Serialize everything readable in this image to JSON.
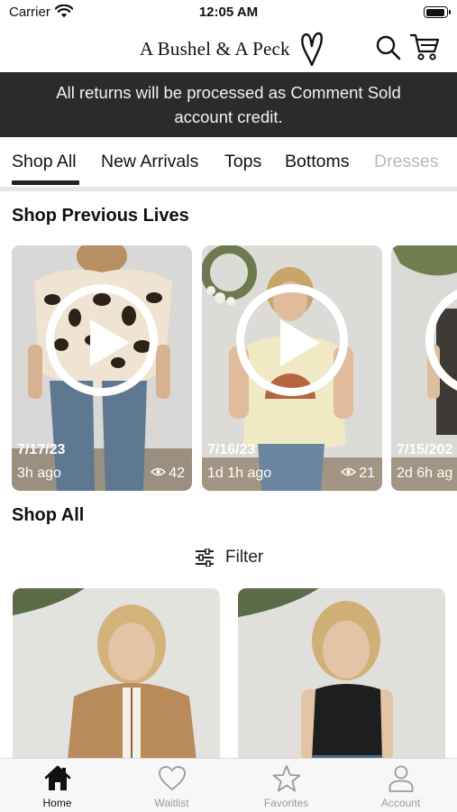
{
  "status_bar": {
    "carrier": "Carrier",
    "time": "12:05 AM",
    "battery_level": 0.95
  },
  "header": {
    "brand": "A Bushel & A Peck",
    "icons": [
      "heart-logo-icon",
      "search-icon",
      "cart-icon"
    ]
  },
  "banner": {
    "line1": "All returns will be processed as Comment Sold",
    "line2": "account credit."
  },
  "tabs": [
    {
      "label": "Shop All",
      "active": true
    },
    {
      "label": "New Arrivals",
      "active": false
    },
    {
      "label": "Tops",
      "active": false
    },
    {
      "label": "Bottoms",
      "active": false
    },
    {
      "label": "Dresses",
      "active": false
    }
  ],
  "previous_lives": {
    "title": "Shop Previous Lives",
    "items": [
      {
        "date": "7/17/23",
        "ago": "3h ago",
        "views": "42"
      },
      {
        "date": "7/16/23",
        "ago": "1d 1h ago",
        "views": "21"
      },
      {
        "date": "7/15/202",
        "ago": "2d 6h ag",
        "views": ""
      }
    ]
  },
  "shop_all": {
    "title": "Shop All",
    "filter_label": "Filter"
  },
  "tabbar": [
    {
      "label": "Home",
      "icon": "home-icon",
      "active": true
    },
    {
      "label": "Waitlist",
      "icon": "heart-icon",
      "active": false
    },
    {
      "label": "Favorites",
      "icon": "star-icon",
      "active": false
    },
    {
      "label": "Account",
      "icon": "person-icon",
      "active": false
    }
  ],
  "colors": {
    "banner_bg": "#2b2b2b",
    "text": "#111111",
    "inactive": "#9a9a9a"
  }
}
